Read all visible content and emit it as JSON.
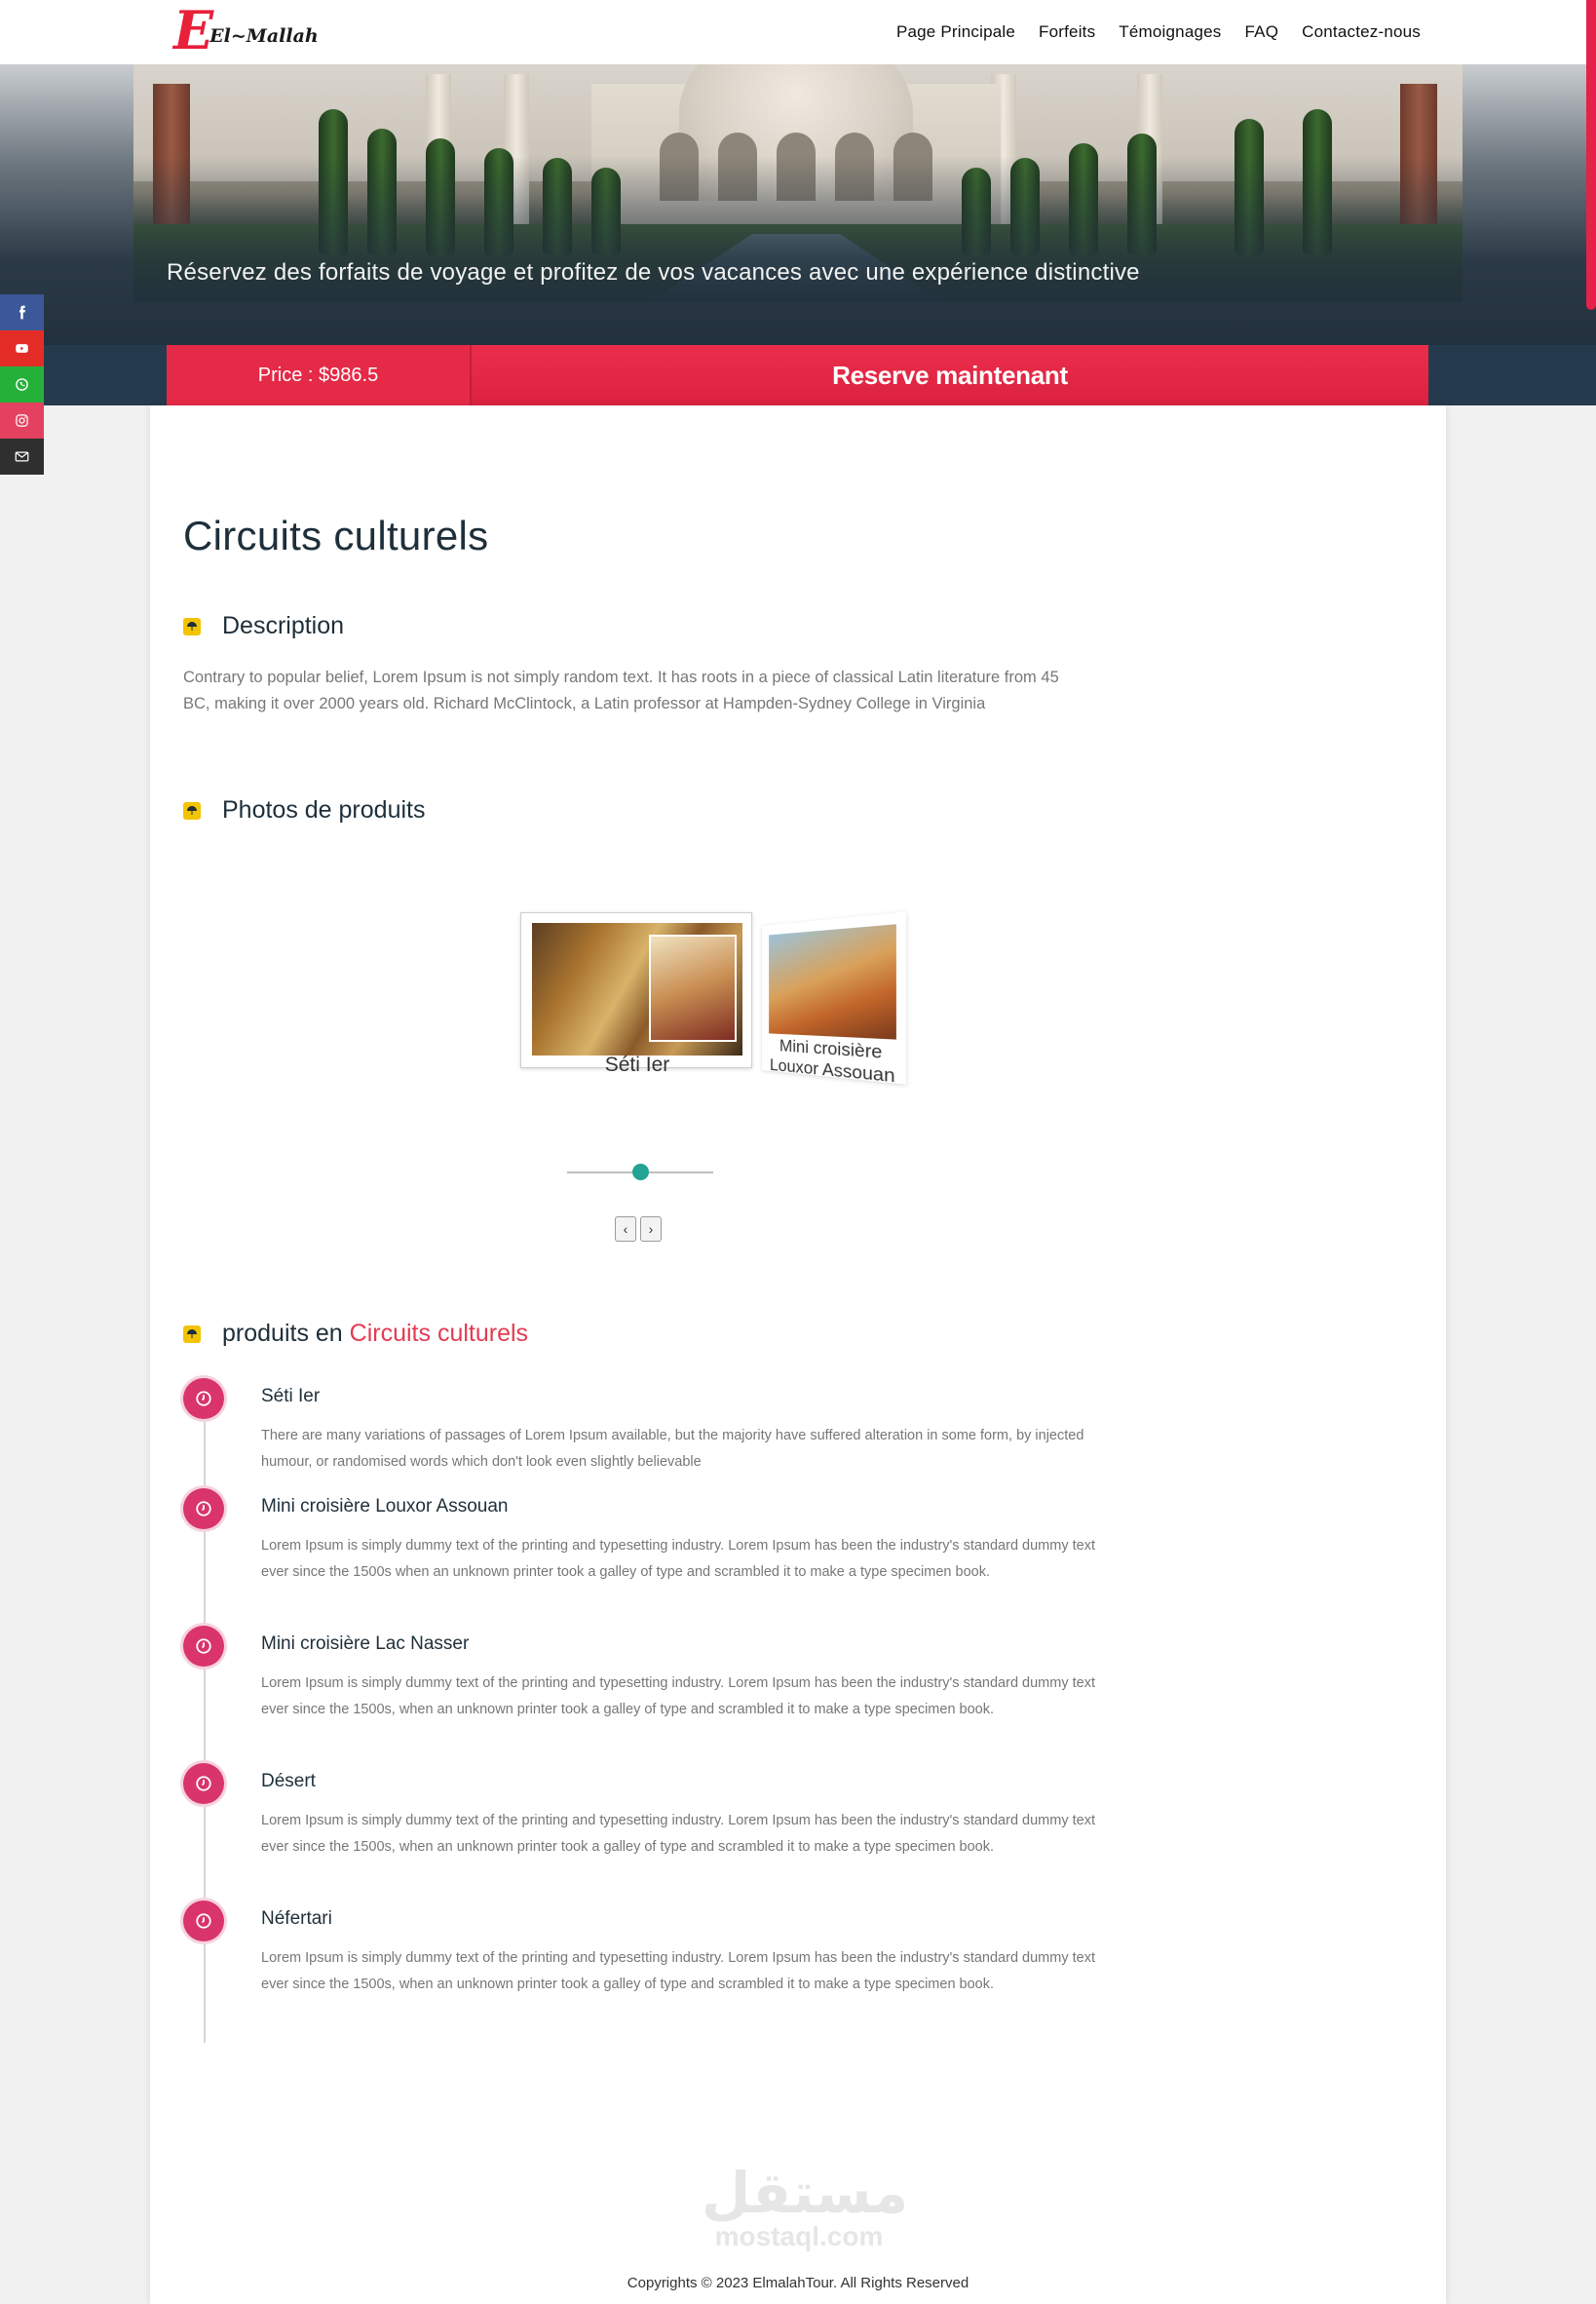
{
  "brand": {
    "logo_letter": "E",
    "logo_text": "El~Mallah"
  },
  "nav": {
    "items": [
      {
        "label": "Page Principale"
      },
      {
        "label": "Forfeits"
      },
      {
        "label": "Témoignages"
      },
      {
        "label": "FAQ"
      },
      {
        "label": "Contactez-nous"
      }
    ]
  },
  "hero": {
    "tagline": "Réservez des forfaits de voyage et profitez de vos vacances avec une expérience distinctive"
  },
  "booking": {
    "price_label": "Price : $986.5",
    "reserve_label": "Reserve maintenant"
  },
  "social": {
    "items": [
      {
        "icon": "facebook-icon",
        "color": "#3b5998"
      },
      {
        "icon": "youtube-icon",
        "color": "#e52d27"
      },
      {
        "icon": "whatsapp-icon",
        "color": "#25b03a"
      },
      {
        "icon": "instagram-icon",
        "color": "#e4405f"
      },
      {
        "icon": "mail-icon",
        "color": "#2f2f2f"
      }
    ]
  },
  "page": {
    "title": "Circuits culturels",
    "description_heading": "Description",
    "description": "Contrary to popular belief, Lorem Ipsum is not simply random text. It has roots in a piece of classical Latin literature from 45 BC, making it over 2000 years old. Richard McClintock, a Latin professor at Hampden-Sydney College in Virginia",
    "photos_heading": "Photos de produits",
    "products_heading_prefix": "produits en",
    "products_heading_highlight": "Circuits culturels"
  },
  "gallery": {
    "slides": [
      {
        "caption": "Séti Ier"
      },
      {
        "caption": "Mini croisière Louxor Assouan"
      }
    ],
    "prev_label": "‹",
    "next_label": "›",
    "position": 0.5
  },
  "products": [
    {
      "title": "Séti Ier",
      "text": "There are many variations of passages of Lorem Ipsum available, but the majority have suffered alteration in some form, by injected humour, or randomised words which don't look even slightly believable"
    },
    {
      "title": "Mini croisière Louxor Assouan",
      "text": "Lorem Ipsum is simply dummy text of the printing and typesetting industry. Lorem Ipsum has been the industry's standard dummy text ever since the 1500s when an unknown printer took a galley of type and scrambled it to make a type specimen book."
    },
    {
      "title": "Mini croisière Lac Nasser",
      "text": "Lorem Ipsum is simply dummy text of the printing and typesetting industry. Lorem Ipsum has been the industry's standard dummy text ever since the 1500s, when an unknown printer took a galley of type and scrambled it to make a type specimen book."
    },
    {
      "title": "Désert",
      "text": "Lorem Ipsum is simply dummy text of the printing and typesetting industry. Lorem Ipsum has been the industry's standard dummy text ever since the 1500s, when an unknown printer took a galley of type and scrambled it to make a type specimen book."
    },
    {
      "title": "Néfertari",
      "text": "Lorem Ipsum is simply dummy text of the printing and typesetting industry. Lorem Ipsum has been the industry's standard dummy text ever since the 1500s, when an unknown printer took a galley of type and scrambled it to make a type specimen book."
    }
  ],
  "watermark": {
    "arabic": "مستقل",
    "latin": "mostaql.com"
  },
  "footer": {
    "copyright": "Copyrights © 2023 ElmalahTour. All Rights Reserved"
  },
  "colors": {
    "accent": "#e52a47",
    "timeline_dot": "#d9346c",
    "slider": "#24a394",
    "navy": "#263a4d"
  }
}
